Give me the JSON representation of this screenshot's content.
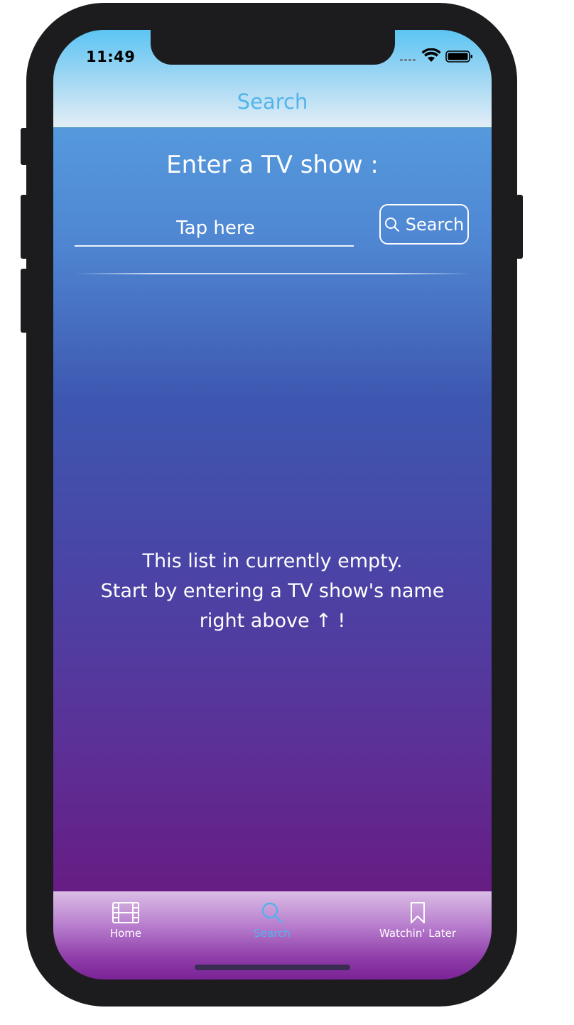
{
  "status_bar": {
    "time": "11:49"
  },
  "nav": {
    "title": "Search"
  },
  "search": {
    "heading": "Enter a TV show :",
    "placeholder": "Tap here",
    "button_label": "Search"
  },
  "empty_state": {
    "line1": "This list in currently empty.",
    "line2": "Start by entering a TV show's name",
    "line3": "right above ↑ !"
  },
  "tabs": [
    {
      "label": "Home",
      "icon": "film-icon",
      "selected": false
    },
    {
      "label": "Search",
      "icon": "search-icon",
      "selected": true
    },
    {
      "label": "Watchin' Later",
      "icon": "bookmark-icon",
      "selected": false
    }
  ],
  "colors": {
    "accent": "#52b3ec",
    "tab_text": "#ffffff",
    "gradient_top": "#5aa9e6",
    "gradient_bottom": "#671d84"
  }
}
